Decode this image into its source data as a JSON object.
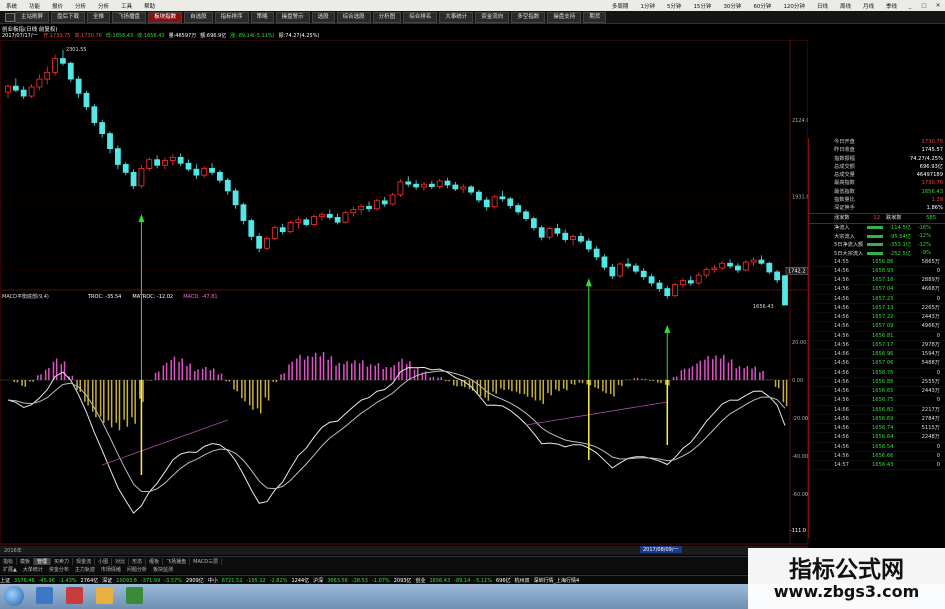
{
  "menubar": {
    "items": [
      "系统",
      "功能",
      "报价",
      "分析",
      "分析",
      "工具",
      "帮助"
    ],
    "periods": [
      "多周期",
      "1分钟",
      "5分钟",
      "15分钟",
      "30分钟",
      "60分钟",
      "120分钟",
      "日线",
      "周线",
      "月线",
      "季线"
    ]
  },
  "toolbar": {
    "buttons": [
      "主站刷屏",
      "盘后下载",
      "全推",
      "飞扬播盘",
      "板块指数",
      "自选股",
      "指标排序",
      "策略",
      "操盘警示",
      "选股",
      "综合选股",
      "分析图",
      "综合排名",
      "大事统计",
      "资金流向",
      "多空指数",
      "操盘支持",
      "期货"
    ],
    "active_index": 4
  },
  "chart": {
    "title": "创业板指(日线 前复权)",
    "quote_date": "2017/07/17/一",
    "quote_items": [
      {
        "text": "开:1730.75",
        "color": "red"
      },
      {
        "text": "高:1730.76",
        "color": "red"
      },
      {
        "text": "低:1656.43",
        "color": "green"
      },
      {
        "text": "收:1656.43",
        "color": "green"
      },
      {
        "text": "量:46597万",
        "color": "white"
      },
      {
        "text": "额:696.9亿",
        "color": "white"
      },
      {
        "text": "涨:-89.14(-5.11%)",
        "color": "green"
      },
      {
        "text": "振:74.27(4.25%)",
        "color": "white"
      }
    ],
    "high_label": "2301.55",
    "low_label": "1656.43",
    "right_price_label": "1742.2",
    "y_ticks": [
      "2124.0",
      "1931.0",
      "1744.0"
    ],
    "candles": [
      [
        2195,
        2215,
        2180,
        2210
      ],
      [
        2210,
        2230,
        2195,
        2200
      ],
      [
        2200,
        2210,
        2178,
        2185
      ],
      [
        2185,
        2215,
        2180,
        2208
      ],
      [
        2208,
        2240,
        2200,
        2228
      ],
      [
        2228,
        2260,
        2215,
        2245
      ],
      [
        2245,
        2290,
        2236,
        2280
      ],
      [
        2280,
        2301.55,
        2262,
        2268
      ],
      [
        2268,
        2272,
        2220,
        2228
      ],
      [
        2228,
        2235,
        2180,
        2192
      ],
      [
        2192,
        2198,
        2150,
        2158
      ],
      [
        2158,
        2165,
        2110,
        2118
      ],
      [
        2118,
        2125,
        2080,
        2090
      ],
      [
        2090,
        2095,
        2040,
        2052
      ],
      [
        2052,
        2060,
        2000,
        2012
      ],
      [
        2012,
        2018,
        1985,
        1992
      ],
      [
        1992,
        2000,
        1950,
        1958
      ],
      [
        1958,
        2010,
        1952,
        2002
      ],
      [
        2002,
        2030,
        1995,
        2024
      ],
      [
        2024,
        2035,
        2002,
        2010
      ],
      [
        2010,
        2030,
        2000,
        2022
      ],
      [
        2022,
        2038,
        2010,
        2030
      ],
      [
        2030,
        2040,
        2008,
        2015
      ],
      [
        2015,
        2025,
        1995,
        2000
      ],
      [
        2000,
        2012,
        1975,
        1985
      ],
      [
        1985,
        2008,
        1978,
        2002
      ],
      [
        2002,
        2015,
        1985,
        1992
      ],
      [
        1992,
        1998,
        1965,
        1972
      ],
      [
        1972,
        1978,
        1935,
        1945
      ],
      [
        1945,
        1952,
        1900,
        1910
      ],
      [
        1910,
        1915,
        1860,
        1870
      ],
      [
        1870,
        1875,
        1820,
        1830
      ],
      [
        1830,
        1838,
        1790,
        1800
      ],
      [
        1800,
        1830,
        1795,
        1825
      ],
      [
        1825,
        1858,
        1820,
        1852
      ],
      [
        1852,
        1862,
        1835,
        1842
      ],
      [
        1842,
        1870,
        1838,
        1865
      ],
      [
        1865,
        1880,
        1850,
        1872
      ],
      [
        1872,
        1878,
        1855,
        1860
      ],
      [
        1860,
        1885,
        1855,
        1880
      ],
      [
        1880,
        1892,
        1870,
        1886
      ],
      [
        1886,
        1898,
        1872,
        1878
      ],
      [
        1878,
        1888,
        1860,
        1866
      ],
      [
        1866,
        1895,
        1862,
        1890
      ],
      [
        1890,
        1905,
        1880,
        1898
      ],
      [
        1898,
        1912,
        1885,
        1906
      ],
      [
        1906,
        1918,
        1892,
        1900
      ],
      [
        1900,
        1925,
        1895,
        1920
      ],
      [
        1920,
        1930,
        1905,
        1912
      ],
      [
        1912,
        1940,
        1908,
        1935
      ],
      [
        1935,
        1975,
        1930,
        1968
      ],
      [
        1968,
        1982,
        1955,
        1962
      ],
      [
        1962,
        1972,
        1948,
        1955
      ],
      [
        1955,
        1968,
        1945,
        1962
      ],
      [
        1962,
        1970,
        1950,
        1956
      ],
      [
        1956,
        1975,
        1950,
        1970
      ],
      [
        1970,
        1978,
        1952,
        1960
      ],
      [
        1960,
        1968,
        1945,
        1950
      ],
      [
        1950,
        1962,
        1940,
        1955
      ],
      [
        1955,
        1960,
        1935,
        1942
      ],
      [
        1942,
        1948,
        1915,
        1922
      ],
      [
        1922,
        1930,
        1895,
        1905
      ],
      [
        1905,
        1935,
        1900,
        1930
      ],
      [
        1930,
        1945,
        1918,
        1925
      ],
      [
        1925,
        1930,
        1900,
        1908
      ],
      [
        1908,
        1915,
        1885,
        1892
      ],
      [
        1892,
        1898,
        1868,
        1875
      ],
      [
        1875,
        1880,
        1845,
        1852
      ],
      [
        1852,
        1858,
        1820,
        1828
      ],
      [
        1828,
        1855,
        1822,
        1850
      ],
      [
        1850,
        1862,
        1830,
        1838
      ],
      [
        1838,
        1848,
        1815,
        1822
      ],
      [
        1822,
        1835,
        1808,
        1830
      ],
      [
        1830,
        1840,
        1812,
        1818
      ],
      [
        1818,
        1825,
        1790,
        1798
      ],
      [
        1798,
        1805,
        1770,
        1778
      ],
      [
        1778,
        1785,
        1745,
        1752
      ],
      [
        1752,
        1760,
        1722,
        1730
      ],
      [
        1730,
        1765,
        1725,
        1760
      ],
      [
        1760,
        1775,
        1748,
        1755
      ],
      [
        1755,
        1762,
        1735,
        1742
      ],
      [
        1742,
        1750,
        1720,
        1728
      ],
      [
        1728,
        1735,
        1705,
        1712
      ],
      [
        1712,
        1720,
        1690,
        1698
      ],
      [
        1698,
        1705,
        1672,
        1680
      ],
      [
        1680,
        1712,
        1676,
        1708
      ],
      [
        1708,
        1725,
        1700,
        1718
      ],
      [
        1718,
        1730,
        1705,
        1712
      ],
      [
        1712,
        1738,
        1708,
        1732
      ],
      [
        1732,
        1752,
        1725,
        1746
      ],
      [
        1746,
        1758,
        1738,
        1750
      ],
      [
        1750,
        1768,
        1745,
        1762
      ],
      [
        1762,
        1772,
        1748,
        1755
      ],
      [
        1755,
        1762,
        1738,
        1745
      ],
      [
        1745,
        1770,
        1742,
        1765
      ],
      [
        1765,
        1778,
        1755,
        1770
      ],
      [
        1770,
        1782,
        1758,
        1762
      ],
      [
        1762,
        1766,
        1735,
        1740
      ],
      [
        1740,
        1745,
        1712,
        1720
      ],
      [
        1730.75,
        1730.76,
        1656.43,
        1656.43
      ]
    ],
    "signal_arrows": [
      17,
      74,
      84
    ],
    "macd": {
      "title": "MACD平衡底部(9,4)",
      "items": [
        {
          "text": "TROC: -35.54",
          "color": "white"
        },
        {
          "text": "MATROC: -12.02",
          "color": "white"
        },
        {
          "text": "MACD: -47.81",
          "color": "pink"
        }
      ],
      "y_ticks": [
        "20.00",
        "0.00",
        "-20.00",
        "-40.00",
        "-60.00"
      ],
      "bottom_label": "-111.0"
    },
    "axis_start": "2016年",
    "cursor_date": "2017/08/09/一"
  },
  "right_panel": {
    "stats": [
      {
        "label": "今日开盘",
        "value": "1730.75",
        "color": "red"
      },
      {
        "label": "昨日收盘",
        "value": "1745.57",
        "color": "white"
      },
      {
        "label": "指数振幅",
        "value": "74.27/4.25%",
        "color": "white"
      },
      {
        "label": "总成交额",
        "value": "696.93亿",
        "color": "white"
      },
      {
        "label": "总成交量",
        "value": "46497189",
        "color": "white"
      },
      {
        "label": "最高指数",
        "value": "1730.76",
        "color": "red"
      },
      {
        "label": "最低指数",
        "value": "1656.43",
        "color": "green"
      },
      {
        "label": "指数量比",
        "value": "1.39",
        "color": "red"
      },
      {
        "label": "深证换手",
        "value": "1.86%",
        "color": "white"
      }
    ],
    "zd": {
      "up_label": "涨家数",
      "up": "12",
      "down_label": "跌家数",
      "down": "585"
    },
    "flows": [
      {
        "label": "净流入",
        "value": "-114.5亿",
        "pct": "-16%"
      },
      {
        "label": "大宗流入",
        "value": "-95.54亿",
        "pct": "-12%"
      },
      {
        "label": "5日净流入额",
        "value": "-353.1亿",
        "pct": "-12%"
      },
      {
        "label": "5日大宗流入",
        "value": "-252.5亿",
        "pct": "-9%"
      }
    ],
    "ticks": [
      {
        "t": "14:55",
        "p": "1656.86",
        "v": "5865万"
      },
      {
        "t": "14:56",
        "p": "1656.93",
        "v": "0"
      },
      {
        "t": "14:56",
        "p": "1657.16",
        "v": "2889万"
      },
      {
        "t": "14:56",
        "p": "1657.04",
        "v": "4668万"
      },
      {
        "t": "14:56",
        "p": "1657.23",
        "v": "0"
      },
      {
        "t": "14:56",
        "p": "1657.13",
        "v": "2265万"
      },
      {
        "t": "14:56",
        "p": "1657.22",
        "v": "2443万"
      },
      {
        "t": "14:56",
        "p": "1657.09",
        "v": "4966万"
      },
      {
        "t": "14:56",
        "p": "1656.81",
        "v": "0"
      },
      {
        "t": "14:56",
        "p": "1657.17",
        "v": "2978万"
      },
      {
        "t": "14:56",
        "p": "1656.96",
        "v": "1594万"
      },
      {
        "t": "14:56",
        "p": "1657.06",
        "v": "5488万"
      },
      {
        "t": "14:56",
        "p": "1656.76",
        "v": "0"
      },
      {
        "t": "14:56",
        "p": "1656.88",
        "v": "2555万"
      },
      {
        "t": "14:56",
        "p": "1656.65",
        "v": "2443万"
      },
      {
        "t": "14:56",
        "p": "1656.75",
        "v": "0"
      },
      {
        "t": "14:56",
        "p": "1656.82",
        "v": "2217万"
      },
      {
        "t": "14:56",
        "p": "1656.69",
        "v": "2784万"
      },
      {
        "t": "14:56",
        "p": "1656.74",
        "v": "5115万"
      },
      {
        "t": "14:56",
        "p": "1656.64",
        "v": "2248万"
      },
      {
        "t": "14:56",
        "p": "1656.54",
        "v": "0"
      },
      {
        "t": "14:56",
        "p": "1656.66",
        "v": "0"
      },
      {
        "t": "14:57",
        "p": "1656.43",
        "v": "0"
      }
    ]
  },
  "bottom_tabs": [
    "指标",
    "模板",
    "管理",
    "买卖力",
    "现金流",
    "小图",
    "对比",
    "形态",
    "缠板",
    "飞扬播盘",
    "MACD三层"
  ],
  "bottom_tabs_active": 2,
  "sub_tabs": [
    "扩展▲",
    "大单统计",
    "资金分布",
    "主力轨迹",
    "市场情绪",
    "问题分析",
    "板块监测"
  ],
  "status_items": [
    {
      "text": "上证",
      "color": "white"
    },
    {
      "text": "3176.46",
      "color": "green"
    },
    {
      "text": "-45.96",
      "color": "green"
    },
    {
      "text": "-1.43%",
      "color": "green"
    },
    {
      "text": "2764亿",
      "color": "white"
    },
    {
      "text": "深证",
      "color": "white"
    },
    {
      "text": "10093.8",
      "color": "green"
    },
    {
      "text": "-371.99",
      "color": "green"
    },
    {
      "text": "-3.57%",
      "color": "green"
    },
    {
      "text": "2909亿",
      "color": "white"
    },
    {
      "text": "中小",
      "color": "white"
    },
    {
      "text": "6721.52",
      "color": "green"
    },
    {
      "text": "-195.12",
      "color": "green"
    },
    {
      "text": "-2.82%",
      "color": "green"
    },
    {
      "text": "1244亿",
      "color": "white"
    },
    {
      "text": "沪深",
      "color": "white"
    },
    {
      "text": "3663.56",
      "color": "green"
    },
    {
      "text": "-38.53",
      "color": "green"
    },
    {
      "text": "-1.07%",
      "color": "green"
    },
    {
      "text": "2093亿",
      "color": "white"
    },
    {
      "text": "创业",
      "color": "white"
    },
    {
      "text": "1656.43",
      "color": "green"
    },
    {
      "text": "-89.14",
      "color": "green"
    },
    {
      "text": "-5.11%",
      "color": "green"
    },
    {
      "text": "696亿",
      "color": "white"
    },
    {
      "text": "杭州双",
      "color": "white"
    },
    {
      "text": "深圳行情_上海行情4",
      "color": "white"
    }
  ],
  "watermark": {
    "line1": "指标公式网",
    "line2": "www.zbgs3.com"
  }
}
